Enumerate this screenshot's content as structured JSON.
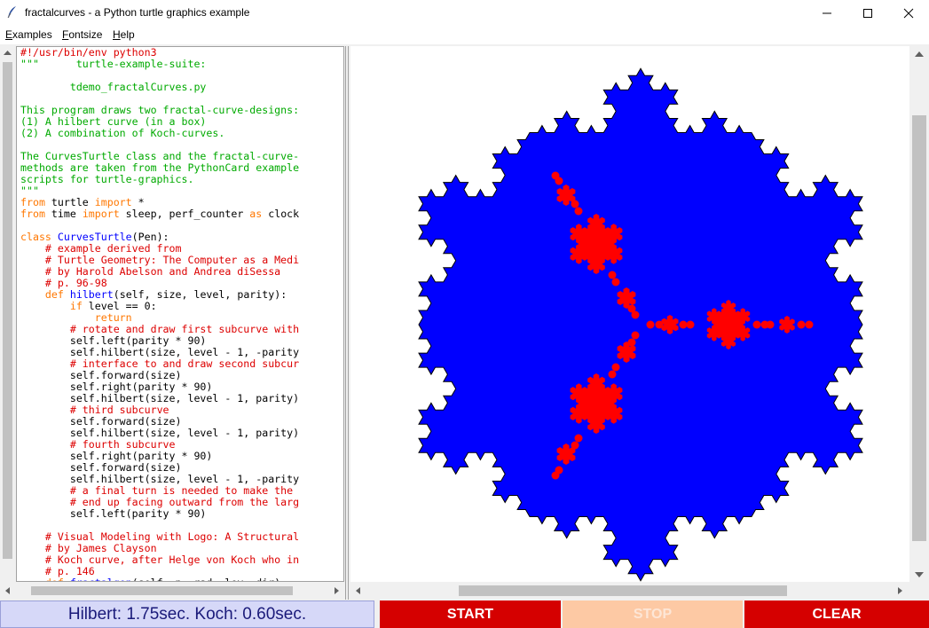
{
  "window": {
    "title": "fractalcurves - a Python turtle graphics example",
    "controls": [
      "minimize",
      "maximize",
      "close"
    ]
  },
  "menu": [
    {
      "label": "Examples"
    },
    {
      "label": "Fontsize"
    },
    {
      "label": "Help"
    }
  ],
  "code": [
    [
      [
        "cm",
        "#!/usr/bin/env python3"
      ]
    ],
    [
      [
        "str",
        "\"\"\"      turtle-example-suite:"
      ]
    ],
    [
      [
        "str",
        ""
      ]
    ],
    [
      [
        "str",
        "        tdemo_fractalCurves.py"
      ]
    ],
    [
      [
        "str",
        ""
      ]
    ],
    [
      [
        "str",
        "This program draws two fractal-curve-designs:"
      ]
    ],
    [
      [
        "str",
        "(1) A hilbert curve (in a box)"
      ]
    ],
    [
      [
        "str",
        "(2) A combination of Koch-curves."
      ]
    ],
    [
      [
        "str",
        ""
      ]
    ],
    [
      [
        "str",
        "The CurvesTurtle class and the fractal-curve-"
      ]
    ],
    [
      [
        "str",
        "methods are taken from the PythonCard example"
      ]
    ],
    [
      [
        "str",
        "scripts for turtle-graphics."
      ]
    ],
    [
      [
        "str",
        "\"\"\""
      ]
    ],
    [
      [
        "kw",
        "from"
      ],
      [
        "tx",
        " turtle "
      ],
      [
        "kw",
        "import"
      ],
      [
        "tx",
        " *"
      ]
    ],
    [
      [
        "kw",
        "from"
      ],
      [
        "tx",
        " time "
      ],
      [
        "kw",
        "import"
      ],
      [
        "tx",
        " sleep, perf_counter "
      ],
      [
        "kw",
        "as"
      ],
      [
        "tx",
        " clock"
      ]
    ],
    [
      [
        "tx",
        ""
      ]
    ],
    [
      [
        "kw",
        "class"
      ],
      [
        "tx",
        " "
      ],
      [
        "def",
        "CurvesTurtle"
      ],
      [
        "tx",
        "(Pen):"
      ]
    ],
    [
      [
        "tx",
        "    "
      ],
      [
        "cm",
        "# example derived from"
      ]
    ],
    [
      [
        "tx",
        "    "
      ],
      [
        "cm",
        "# Turtle Geometry: The Computer as a Medi"
      ]
    ],
    [
      [
        "tx",
        "    "
      ],
      [
        "cm",
        "# by Harold Abelson and Andrea diSessa"
      ]
    ],
    [
      [
        "tx",
        "    "
      ],
      [
        "cm",
        "# p. 96-98"
      ]
    ],
    [
      [
        "tx",
        "    "
      ],
      [
        "kw",
        "def"
      ],
      [
        "tx",
        " "
      ],
      [
        "def",
        "hilbert"
      ],
      [
        "tx",
        "(self, size, level, parity):"
      ]
    ],
    [
      [
        "tx",
        "        "
      ],
      [
        "kw",
        "if"
      ],
      [
        "tx",
        " level == 0:"
      ]
    ],
    [
      [
        "tx",
        "            "
      ],
      [
        "kw",
        "return"
      ]
    ],
    [
      [
        "tx",
        "        "
      ],
      [
        "cm",
        "# rotate and draw first subcurve with"
      ]
    ],
    [
      [
        "tx",
        "        self.left(parity * 90)"
      ]
    ],
    [
      [
        "tx",
        "        self.hilbert(size, level - 1, -parity"
      ]
    ],
    [
      [
        "tx",
        "        "
      ],
      [
        "cm",
        "# interface to and draw second subcur"
      ]
    ],
    [
      [
        "tx",
        "        self.forward(size)"
      ]
    ],
    [
      [
        "tx",
        "        self.right(parity * 90)"
      ]
    ],
    [
      [
        "tx",
        "        self.hilbert(size, level - 1, parity)"
      ]
    ],
    [
      [
        "tx",
        "        "
      ],
      [
        "cm",
        "# third subcurve"
      ]
    ],
    [
      [
        "tx",
        "        self.forward(size)"
      ]
    ],
    [
      [
        "tx",
        "        self.hilbert(size, level - 1, parity)"
      ]
    ],
    [
      [
        "tx",
        "        "
      ],
      [
        "cm",
        "# fourth subcurve"
      ]
    ],
    [
      [
        "tx",
        "        self.right(parity * 90)"
      ]
    ],
    [
      [
        "tx",
        "        self.forward(size)"
      ]
    ],
    [
      [
        "tx",
        "        self.hilbert(size, level - 1, -parity"
      ]
    ],
    [
      [
        "tx",
        "        "
      ],
      [
        "cm",
        "# a final turn is needed to make the"
      ]
    ],
    [
      [
        "tx",
        "        "
      ],
      [
        "cm",
        "# end up facing outward from the larg"
      ]
    ],
    [
      [
        "tx",
        "        self.left(parity * 90)"
      ]
    ],
    [
      [
        "tx",
        ""
      ]
    ],
    [
      [
        "tx",
        "    "
      ],
      [
        "cm",
        "# Visual Modeling with Logo: A Structural"
      ]
    ],
    [
      [
        "tx",
        "    "
      ],
      [
        "cm",
        "# by James Clayson"
      ]
    ],
    [
      [
        "tx",
        "    "
      ],
      [
        "cm",
        "# Koch curve, after Helge von Koch who in"
      ]
    ],
    [
      [
        "tx",
        "    "
      ],
      [
        "cm",
        "# p. 146"
      ]
    ],
    [
      [
        "tx",
        "    "
      ],
      [
        "kw",
        "def"
      ],
      [
        "tx",
        " "
      ],
      [
        "def",
        "fractalgon"
      ],
      [
        "tx",
        "(self, n, rad, lev, dir):"
      ]
    ]
  ],
  "status": {
    "timing": "Hilbert: 1.75sec. Koch: 0.60sec."
  },
  "buttons": {
    "start": "START",
    "stop": "STOP",
    "clear": "CLEAR"
  },
  "colors": {
    "syntax_keyword": "#ff7700",
    "syntax_string": "#00aa00",
    "syntax_comment": "#dd0000",
    "syntax_defname": "#0000ff",
    "koch_fill": "#0000ff",
    "hilbert_fill": "#ff0000",
    "start_bg": "#d50000",
    "stop_bg": "#fdc9a4",
    "clear_bg": "#d50000",
    "timing_bg": "#d6d8f8"
  }
}
